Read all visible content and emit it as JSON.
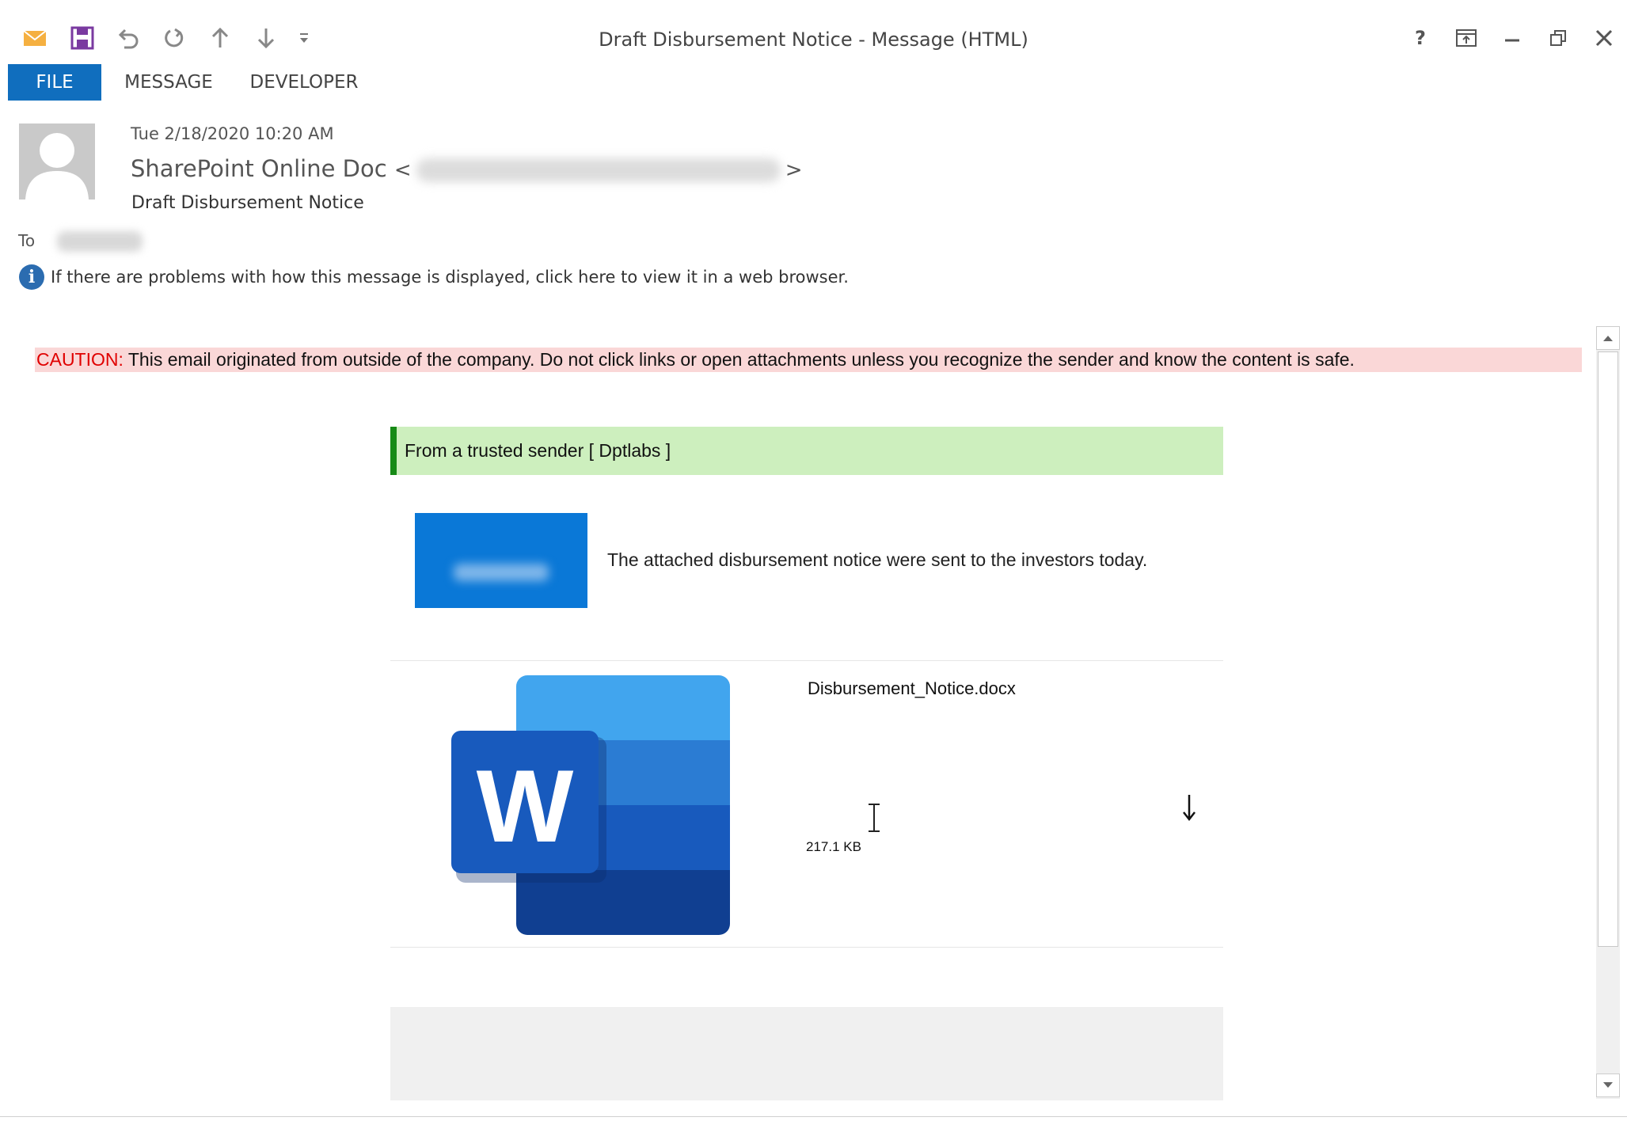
{
  "window": {
    "title": "Draft Disbursement Notice - Message (HTML)"
  },
  "tabs": [
    {
      "label": "FILE"
    },
    {
      "label": "MESSAGE"
    },
    {
      "label": "DEVELOPER"
    }
  ],
  "header": {
    "date": "Tue 2/18/2020 10:20 AM",
    "sender_name": "SharePoint Online Doc",
    "subject": "Draft Disbursement Notice",
    "to_label": "To",
    "info_text": "If there are problems with how this message is displayed, click here to view it in a web browser."
  },
  "body": {
    "caution_label": "CAUTION:",
    "caution_text": " This email originated from outside of the company. Do not click links or open attachments unless you recognize the sender and know the content is safe.",
    "trusted_text": "From a trusted sender [ Dptlabs ]",
    "notice_text": "The attached disbursement notice were sent to the investors today.",
    "attachment": {
      "filename": "Disbursement_Notice.docx",
      "size": "217.1 KB"
    }
  },
  "colors": {
    "file_tab": "#106ebe",
    "caution_bg": "#fad7d7",
    "caution_label": "#e00000",
    "trusted_bg": "#cdefbe",
    "trusted_border": "#168a16",
    "logo_box": "#0a78d7"
  },
  "icons": [
    "envelope-icon",
    "save-icon",
    "undo-icon",
    "redo-icon",
    "up-arrow-icon",
    "down-arrow-icon",
    "customize-icon",
    "help-icon",
    "ribbon-display-icon",
    "minimize-icon",
    "restore-icon",
    "close-icon",
    "info-icon",
    "word-document-icon",
    "download-icon"
  ]
}
